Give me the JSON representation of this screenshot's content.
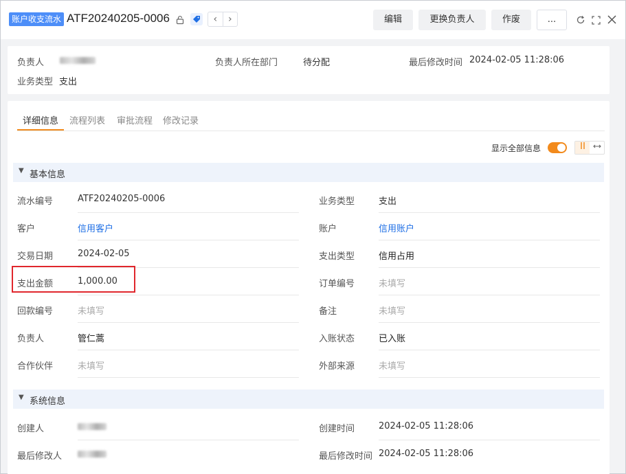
{
  "header": {
    "tag": "账户收支流水",
    "title": "ATF20240205-0006",
    "icons": {
      "lock": "lock-icon",
      "tag": "tag-icon",
      "prev": "chevron-left-icon",
      "next": "chevron-right-icon",
      "refresh": "refresh-icon",
      "expand": "expand-icon",
      "close": "close-icon"
    },
    "prev_glyph": "‹",
    "next_glyph": "›",
    "buttons": {
      "edit": "编辑",
      "change_owner": "更换负责人",
      "void": "作废",
      "more": "..."
    }
  },
  "summary": {
    "owner_label": "负责人",
    "dept_label": "负责人所在部门",
    "dept_value": "待分配",
    "modified_label": "最后修改时间",
    "modified_value": "2024-02-05 11:28:06",
    "biz_type_label": "业务类型",
    "biz_type_value": "支出"
  },
  "tabs": [
    "详细信息",
    "流程列表",
    "审批流程",
    "修改记录"
  ],
  "show_all_label": "显示全部信息",
  "show_all_on": true,
  "accent_color": "#f28a1c",
  "sections": {
    "basic": {
      "title": "基本信息",
      "fields": {
        "serial_label": "流水编号",
        "serial_value": "ATF20240205-0006",
        "biztype_label": "业务类型",
        "biztype_value": "支出",
        "customer_label": "客户",
        "customer_value": "信用客户",
        "account_label": "账户",
        "account_value": "信用账户",
        "date_label": "交易日期",
        "date_value": "2024-02-05",
        "exptype_label": "支出类型",
        "exptype_value": "信用占用",
        "amount_label": "支出金额",
        "amount_value": "1,000.00",
        "order_label": "订单编号",
        "order_value": "未填写",
        "refund_label": "回款编号",
        "refund_value": "未填写",
        "remark_label": "备注",
        "remark_value": "未填写",
        "owner_label": "负责人",
        "owner_value": "管仁蒿",
        "status_label": "入账状态",
        "status_value": "已入账",
        "partner_label": "合作伙伴",
        "partner_value": "未填写",
        "source_label": "外部来源",
        "source_value": "未填写"
      }
    },
    "system": {
      "title": "系统信息",
      "fields": {
        "creator_label": "创建人",
        "created_label": "创建时间",
        "created_value": "2024-02-05 11:28:06",
        "modifier_label": "最后修改人",
        "modified_label": "最后修改时间",
        "modified_value": "2024-02-05 11:28:06"
      }
    }
  }
}
